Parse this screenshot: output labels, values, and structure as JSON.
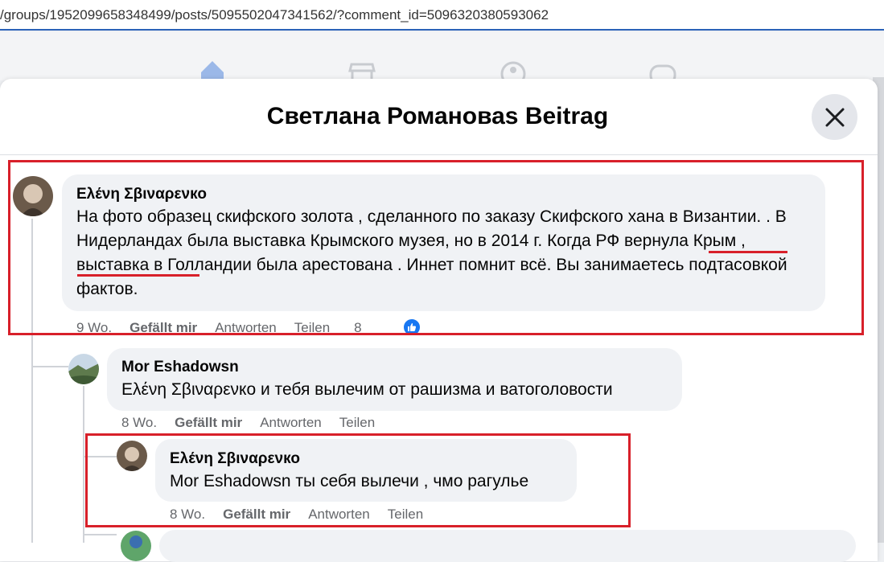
{
  "browser": {
    "url": "/groups/1952099658348499/posts/5095502047341562/?comment_id=5096320380593062"
  },
  "dialog": {
    "title": "Светлана Романоваs Beitrag"
  },
  "comments": [
    {
      "author": "Ελένη Σβιναρενко",
      "text_before": "На фото образец скифского золота , сделанного по заказу Скифского хана в Византии. . В Нидерландах была выставка Крымского музея, но в 2014 г. ",
      "text_highlight": "Когда РФ вернула Крым",
      "text_after": " , выставка в Голландии была арестована . Иннет помнит всё. Вы занимаетесь подтасовкой фактов.",
      "time": "9 Wo.",
      "like": "Gefällt mir",
      "reply": "Antworten",
      "share": "Teilen",
      "reactions": "8"
    },
    {
      "author": "Mor Eshadowsn",
      "text": "Ελένη Σβιναρενко и тебя вылечим от рашизма и ватоголовости",
      "time": "8 Wo.",
      "like": "Gefällt mir",
      "reply": "Antworten",
      "share": "Teilen"
    },
    {
      "author": "Ελένη Σβιναρενко",
      "text": "Mor Eshadowsn ты себя вылечи , чмо рагулье",
      "time": "8 Wo.",
      "like": "Gefällt mir",
      "reply": "Antworten",
      "share": "Teilen"
    }
  ],
  "icons": [
    "home-icon",
    "marketplace-icon",
    "groups-icon",
    "gaming-icon",
    "close-icon",
    "like-icon"
  ],
  "colors": {
    "highlight_box": "#d8202a",
    "accent": "#1877f2"
  }
}
